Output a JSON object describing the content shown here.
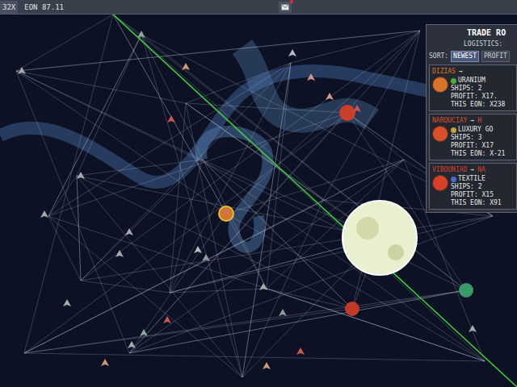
{
  "top_bar": {
    "speed": "32X",
    "eon": "EON 87.11",
    "mail": {
      "unread": true
    }
  },
  "panel": {
    "title": "TRADE RO",
    "subtitle": "LOGISTICS:",
    "sort": {
      "label": "SORT:",
      "options": [
        {
          "label": "NEWEST",
          "selected": true
        },
        {
          "label": "PROFIT",
          "selected": false
        }
      ]
    },
    "routes": [
      {
        "origin": "DIZIAS",
        "arrow": "→",
        "destination": "",
        "commodity": "URANIUM",
        "ships": "SHIPS: 2",
        "profit": "PROFIT: X17.",
        "this_eon": "THIS EON: X238",
        "color": "#d8742a",
        "commodity_color": "#4caf3a"
      },
      {
        "origin": "NAROUCIAY",
        "arrow": "→",
        "destination": "H",
        "commodity": "LUXURY GO",
        "ships": "SHIPS: 3",
        "profit": "PROFIT: X17",
        "this_eon": "THIS EON: X-21",
        "color": "#d9502a",
        "commodity_color": "#c9a03a"
      },
      {
        "origin": "VIBOUNIAD",
        "arrow": "→",
        "destination": "NA",
        "commodity": "TEXTILE",
        "ships": "SHIPS: 2",
        "profit": "PROFIT: X15",
        "this_eon": "THIS EON: X91",
        "color": "#d9402a",
        "commodity_color": "#4a6ad0"
      }
    ]
  }
}
